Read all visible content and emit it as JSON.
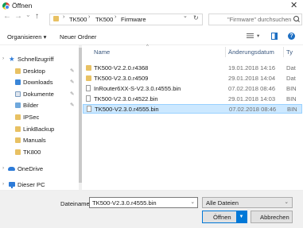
{
  "window": {
    "title": "Öffnen",
    "close_glyph": "✕"
  },
  "nav": {
    "back": "←",
    "forward": "→",
    "dropdown": "⌄",
    "up": "↑"
  },
  "address": {
    "crumbs": [
      "TK500",
      "TK500",
      "Firmware"
    ],
    "separator": "›",
    "history_glyph": "⌄",
    "refresh_glyph": "↻"
  },
  "search": {
    "placeholder": "\"Firmware\" durchsuchen"
  },
  "toolbar": {
    "organize_label": "Organisieren ▾",
    "new_folder_label": "Neuer Ordner",
    "help_glyph": "?",
    "view_dropdown": "▾"
  },
  "sidebar": {
    "items": [
      {
        "label": "Schnellzugriff",
        "icon": "star-icon"
      },
      {
        "label": "Desktop",
        "icon": "folder-icon",
        "pinned": true
      },
      {
        "label": "Downloads",
        "icon": "folder-icon",
        "pinned": true
      },
      {
        "label": "Dokumente",
        "icon": "folder-icon",
        "pinned": true
      },
      {
        "label": "Bilder",
        "icon": "folder-icon",
        "pinned": true
      },
      {
        "label": "IPSec",
        "icon": "folder-icon"
      },
      {
        "label": "LinkBackup",
        "icon": "folder-icon"
      },
      {
        "label": "Manuals",
        "icon": "folder-icon"
      },
      {
        "label": "TK800",
        "icon": "folder-icon"
      },
      {
        "label": "OneDrive",
        "icon": "cloud-icon"
      },
      {
        "label": "Dieser PC",
        "icon": "computer-icon"
      }
    ],
    "pin_glyph": "📌",
    "expander_glyph": "›"
  },
  "filelist": {
    "columns": {
      "name": "Name",
      "date": "Änderungsdatum",
      "type": "Ty"
    },
    "sort_glyph": "^",
    "rows": [
      {
        "name": "TK500-V2.2.0.r4368",
        "date": "19.01.2018 14:16",
        "type": "Dat",
        "kind": "folder"
      },
      {
        "name": "TK500-V2.3.0.r4509",
        "date": "29.01.2018 14:04",
        "type": "Dat",
        "kind": "folder"
      },
      {
        "name": "InRouter6XX-S-V2.3.0.r4555.bin",
        "date": "07.02.2018 08:46",
        "type": "BIN",
        "kind": "file"
      },
      {
        "name": "TK500-V2.3.0.r4522.bin",
        "date": "29.01.2018 14:03",
        "type": "BIN",
        "kind": "file"
      },
      {
        "name": "TK500-V2.3.0.r4555.bin",
        "date": "07.02.2018 08:46",
        "type": "BIN",
        "kind": "file",
        "selected": true
      }
    ]
  },
  "bottom": {
    "filename_label": "Dateiname:",
    "filename_value": "TK500-V2.3.0.r4555.bin",
    "filetype_value": "Alle Dateien",
    "dropdown_glyph": "⌄",
    "open_label": "Öffnen",
    "open_split_glyph": "▼",
    "cancel_label": "Abbrechen"
  },
  "colors": {
    "accent": "#0078d7",
    "selection": "#cce8ff",
    "folder": "#e8c163"
  }
}
